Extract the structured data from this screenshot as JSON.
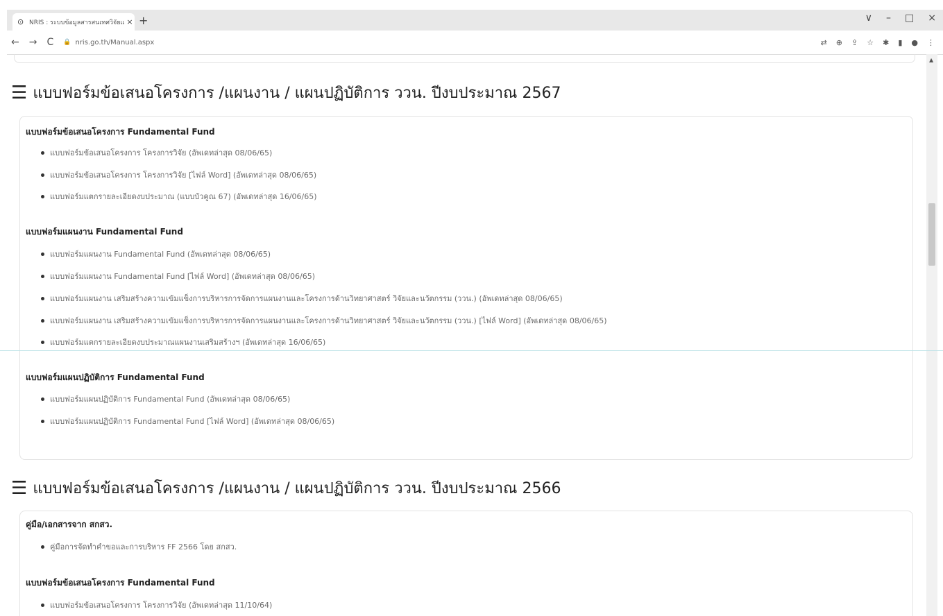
{
  "browser": {
    "tab_title": "NRIS : ระบบข้อมูลสารสนเทศวิจัยและ...",
    "tab_close": "×",
    "new_tab": "+",
    "window_controls": [
      "∨",
      "–",
      "□",
      "×"
    ],
    "nav": [
      "←",
      "→",
      "C"
    ],
    "url": "nris.go.th/Manual.aspx"
  },
  "sections": [
    {
      "title": "แบบฟอร์มข้อเสนอโครงการ /แผนงาน / แผนปฏิบัติการ ววน. ปีงบประมาณ 2567",
      "groups": [
        {
          "heading": "แบบฟอร์มข้อเสนอโครงการ Fundamental Fund",
          "items": [
            "แบบฟอร์มข้อเสนอโครงการ โครงการวิจัย (อัพเดทล่าสุด 08/06/65)",
            "แบบฟอร์มข้อเสนอโครงการ โครงการวิจัย [ไฟล์ Word] (อัพเดทล่าสุด 08/06/65)",
            "แบบฟอร์มแตกรายละเอียดงบประมาณ (แบบบัวคูณ 67) (อัพเดทล่าสุด 16/06/65)"
          ]
        },
        {
          "heading": "แบบฟอร์มแผนงาน Fundamental Fund",
          "items": [
            "แบบฟอร์มแผนงาน Fundamental Fund (อัพเดทล่าสุด 08/06/65)",
            "แบบฟอร์มแผนงาน Fundamental Fund [ไฟล์ Word] (อัพเดทล่าสุด 08/06/65)",
            "แบบฟอร์มแผนงาน เสริมสร้างความเข้มแข็งการบริหารการจัดการแผนงานและโครงการด้านวิทยาศาสตร์ วิจัยและนวัตกรรม (ววน.) (อัพเดทล่าสุด 08/06/65)",
            "แบบฟอร์มแผนงาน เสริมสร้างความเข้มแข็งการบริหารการจัดการแผนงานและโครงการด้านวิทยาศาสตร์ วิจัยและนวัตกรรม (ววน.) [ไฟล์ Word] (อัพเดทล่าสุด 08/06/65)",
            "แบบฟอร์มแตกรายละเอียดงบประมาณแผนงานเสริมสร้างฯ (อัพเดทล่าสุด 16/06/65)"
          ]
        },
        {
          "heading": "แบบฟอร์มแผนปฏิบัติการ Fundamental Fund",
          "items": [
            "แบบฟอร์มแผนปฏิบัติการ Fundamental Fund (อัพเดทล่าสุด 08/06/65)",
            "แบบฟอร์มแผนปฏิบัติการ Fundamental Fund [ไฟล์ Word] (อัพเดทล่าสุด 08/06/65)"
          ]
        }
      ]
    },
    {
      "title": "แบบฟอร์มข้อเสนอโครงการ /แผนงาน / แผนปฏิบัติการ ววน. ปีงบประมาณ 2566",
      "groups": [
        {
          "heading": "คู่มือ/เอกสารจาก สกสว.",
          "items": [
            "คู่มือการจัดทำคำขอและการบริหาร FF 2566 โดย สกสว."
          ]
        },
        {
          "heading": "แบบฟอร์มข้อเสนอโครงการ Fundamental Fund",
          "items": [
            "แบบฟอร์มข้อเสนอโครงการ โครงการวิจัย (อัพเดทล่าสุด 11/10/64)"
          ]
        }
      ]
    }
  ]
}
